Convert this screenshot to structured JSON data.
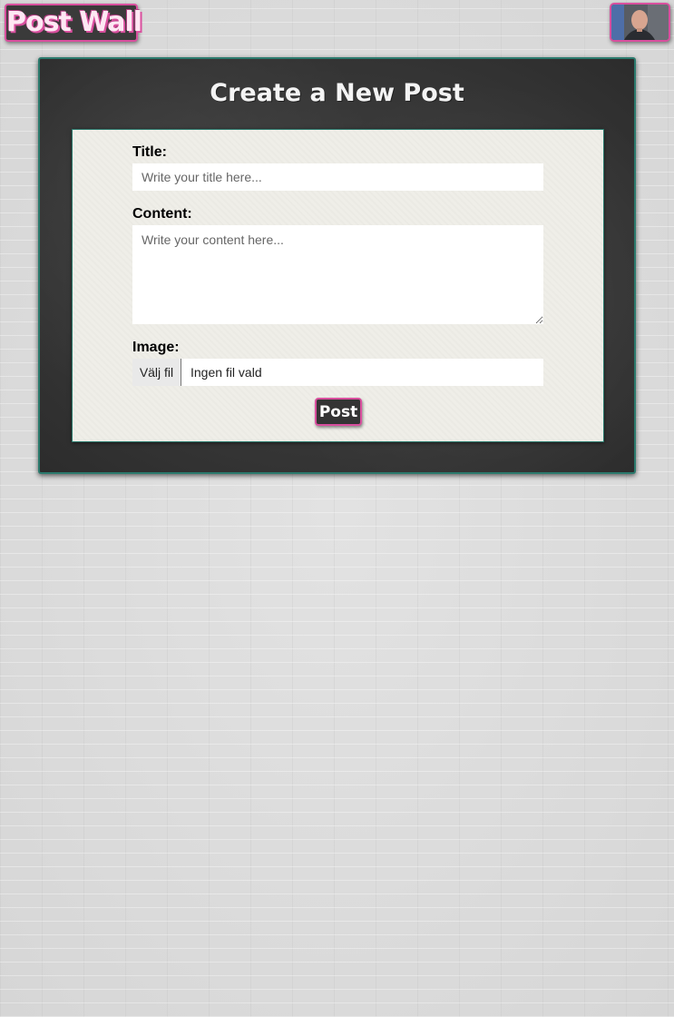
{
  "header": {
    "logo_text": "Post Wall",
    "avatar_icon": "user-avatar-icon"
  },
  "form": {
    "heading": "Create a New Post",
    "title_label": "Title:",
    "title_placeholder": "Write your title here...",
    "title_value": "",
    "content_label": "Content:",
    "content_placeholder": "Write your content here...",
    "content_value": "",
    "image_label": "Image:",
    "file_button_label": "Välj fil",
    "file_status": "Ingen fil vald",
    "submit_label": "Post"
  },
  "colors": {
    "accent_pink": "#d94f9e",
    "board_dark": "#3b3b3b",
    "board_border_teal": "#2b7a6d",
    "paper": "#efeee8"
  }
}
